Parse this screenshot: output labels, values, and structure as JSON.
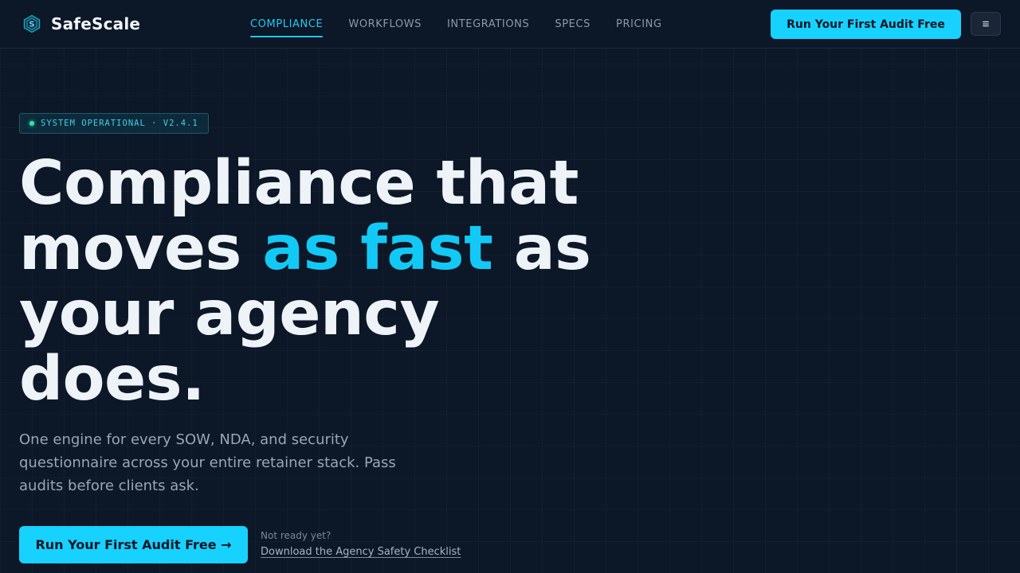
{
  "brand": {
    "name": "SafeScale",
    "logo_icon": "shield-s-logo-icon"
  },
  "nav": {
    "items": [
      {
        "label": "COMPLIANCE",
        "active": true
      },
      {
        "label": "WORKFLOWS",
        "active": false
      },
      {
        "label": "INTEGRATIONS",
        "active": false
      },
      {
        "label": "SPECS",
        "active": false
      },
      {
        "label": "PRICING",
        "active": false
      }
    ]
  },
  "header": {
    "cta_label": "Run Your First Audit Free",
    "menu_icon": "≡"
  },
  "hero": {
    "status_text": "SYSTEM OPERATIONAL · V2.4.1",
    "headline_part1": "Compliance that moves ",
    "headline_accent": "as fast",
    "headline_part2": " as your agency does.",
    "subtitle": "One engine for every SOW, NDA, and security questionnaire across your entire retainer stack. Pass audits before clients ask.",
    "cta_label": "Run Your First Audit Free →",
    "alt_label": "Not ready yet?",
    "alt_link": "Download the Agency Safety Checklist"
  },
  "colors": {
    "background": "#0c1727",
    "accent": "#17d1ff",
    "status_dot": "#2ee6a6",
    "headline": "#eef3f8"
  }
}
